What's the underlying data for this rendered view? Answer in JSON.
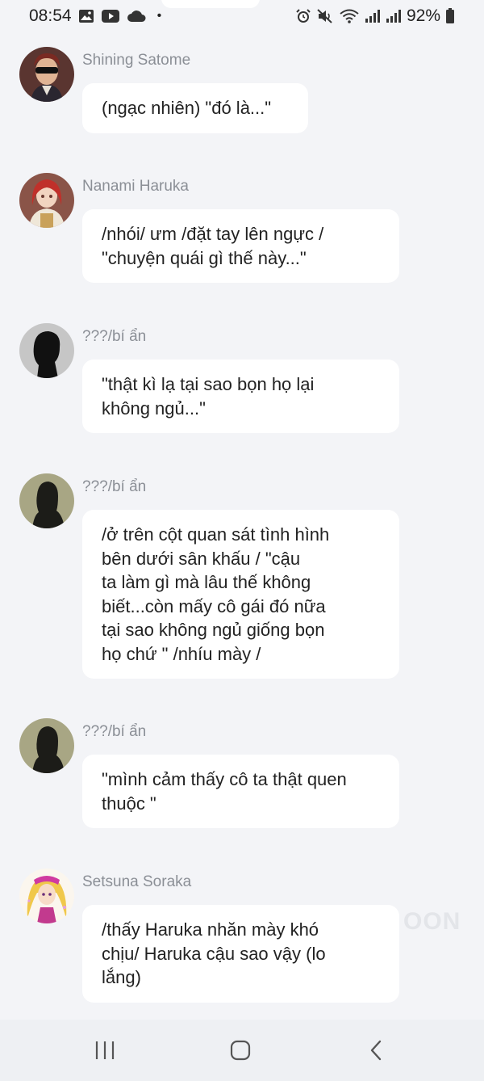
{
  "status_bar": {
    "time": "08:54",
    "dot": "•",
    "battery": "92%",
    "icons_left": [
      "gallery-icon",
      "youtube-icon",
      "cloud-icon"
    ],
    "icons_right": [
      "alarm-icon",
      "mute-icon",
      "wifi-icon",
      "signal-icon",
      "signal-icon",
      "battery-icon"
    ]
  },
  "messages": [
    {
      "name": "Shining Satome",
      "lines": [
        "(ngạc nhiên) \"đó là...\""
      ],
      "avatar": "avatar-shining"
    },
    {
      "name": "Nanami Haruka",
      "lines": [
        "/nhói/ ưm /đặt tay lên ngực /",
        "\"chuyện quái gì thế này...\""
      ],
      "avatar": "avatar-nanami"
    },
    {
      "name": "???/bí ẩn",
      "lines": [
        "\"thật kì lạ tại sao bọn họ lại",
        "không ngủ...\""
      ],
      "avatar": "avatar-silhouette-male"
    },
    {
      "name": "???/bí ẩn",
      "lines": [
        "/ở trên cột quan sát tình hình",
        "bên dưới sân khấu / \"cậu",
        "ta làm gì mà lâu thế không",
        "biết...còn mấy cô gái đó nữa",
        "tại sao không ngủ giống bọn",
        "họ chứ \" /nhíu mày /"
      ],
      "avatar": "avatar-silhouette-female"
    },
    {
      "name": "???/bí ẩn",
      "lines": [
        "\"mình cảm thấy cô ta thật quen",
        "thuộc \""
      ],
      "avatar": "avatar-silhouette-female"
    },
    {
      "name": "Setsuna Soraka",
      "lines": [
        "/thấy Haruka nhăn mày khó",
        "chịu/ Haruka cậu sao vậy (lo",
        "lắng)"
      ],
      "avatar": "avatar-setsuna"
    }
  ],
  "watermark": "OON",
  "nav": {
    "recents": "recents-icon",
    "home": "home-icon",
    "back": "back-icon"
  },
  "colors": {
    "background": "#f3f4f7",
    "bubble": "#ffffff",
    "name": "#8b8f96",
    "text": "#222222"
  }
}
